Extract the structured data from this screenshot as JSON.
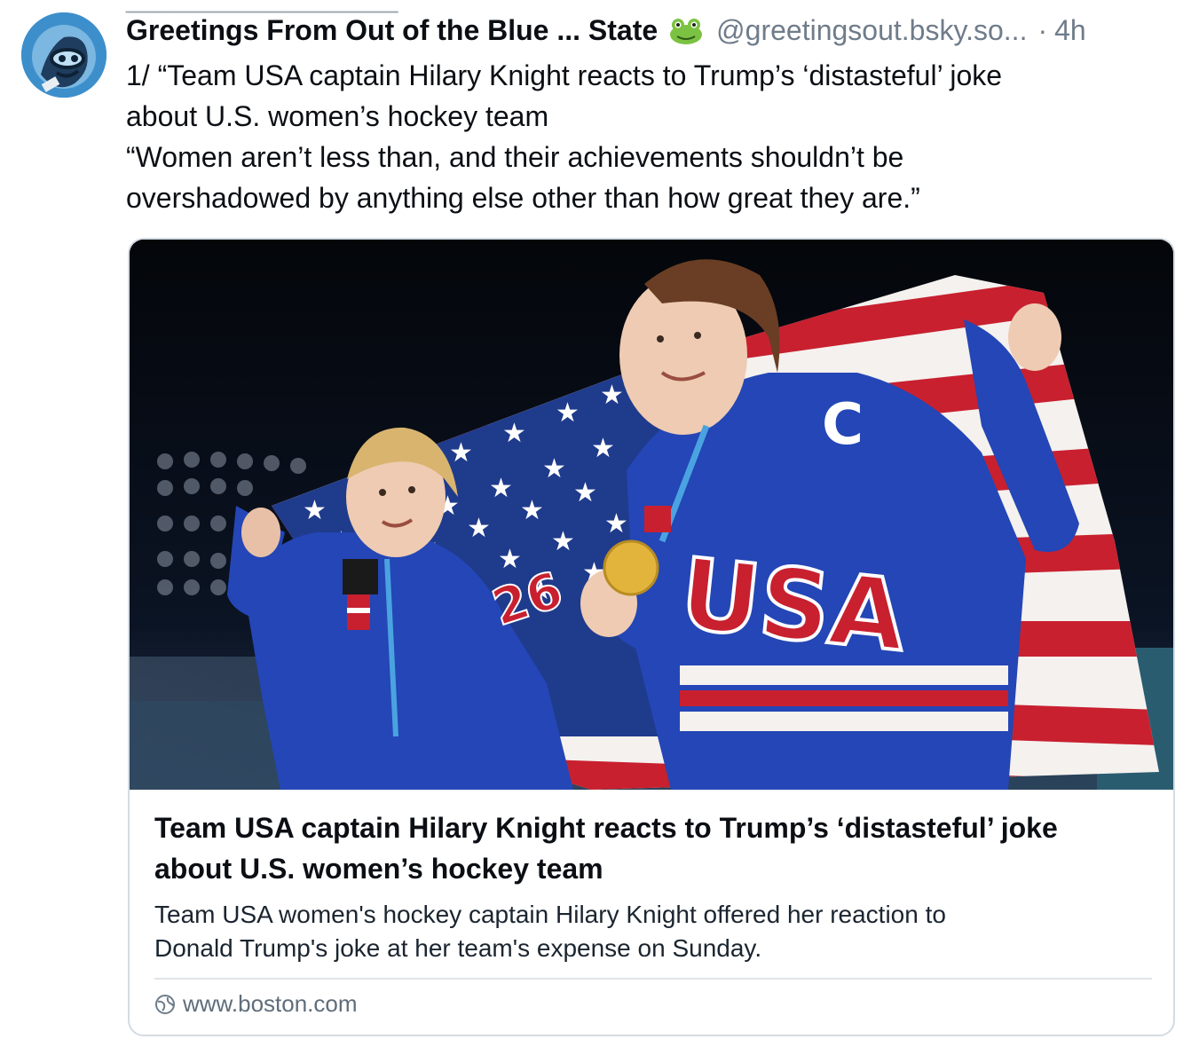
{
  "post": {
    "display_name": "Greetings From Out of the Blue ... State",
    "emoji_icon": "frog-icon",
    "handle": "@greetingsout.bsky.so...",
    "separator": "·",
    "time": "4h",
    "text_lines": [
      "1/ “Team USA captain Hilary Knight reacts to Trump’s ‘distasteful’ joke",
      "about U.S. women’s hockey team",
      "“Women aren’t less than, and their achievements shouldn’t be",
      "overshadowed by anything else other than how great they are.”"
    ]
  },
  "card": {
    "image_text": {
      "jersey_letters": "USA",
      "captain_letter": "C",
      "number": "26"
    },
    "title_lines": [
      "Team USA captain Hilary Knight reacts to Trump’s ‘distasteful’ joke",
      "about U.S. women’s hockey team"
    ],
    "description_lines": [
      "Team USA women's hockey captain Hilary Knight offered her reaction to",
      "Donald Trump's joke at her team's expense on Sunday."
    ],
    "domain": "www.boston.com",
    "domain_icon": "globe-icon"
  },
  "colors": {
    "text": "#0b0f14",
    "muted": "#6f7c8a",
    "card_border": "#d4dbe2",
    "jersey_blue": "#2446b6",
    "flag_red": "#c8202f"
  }
}
